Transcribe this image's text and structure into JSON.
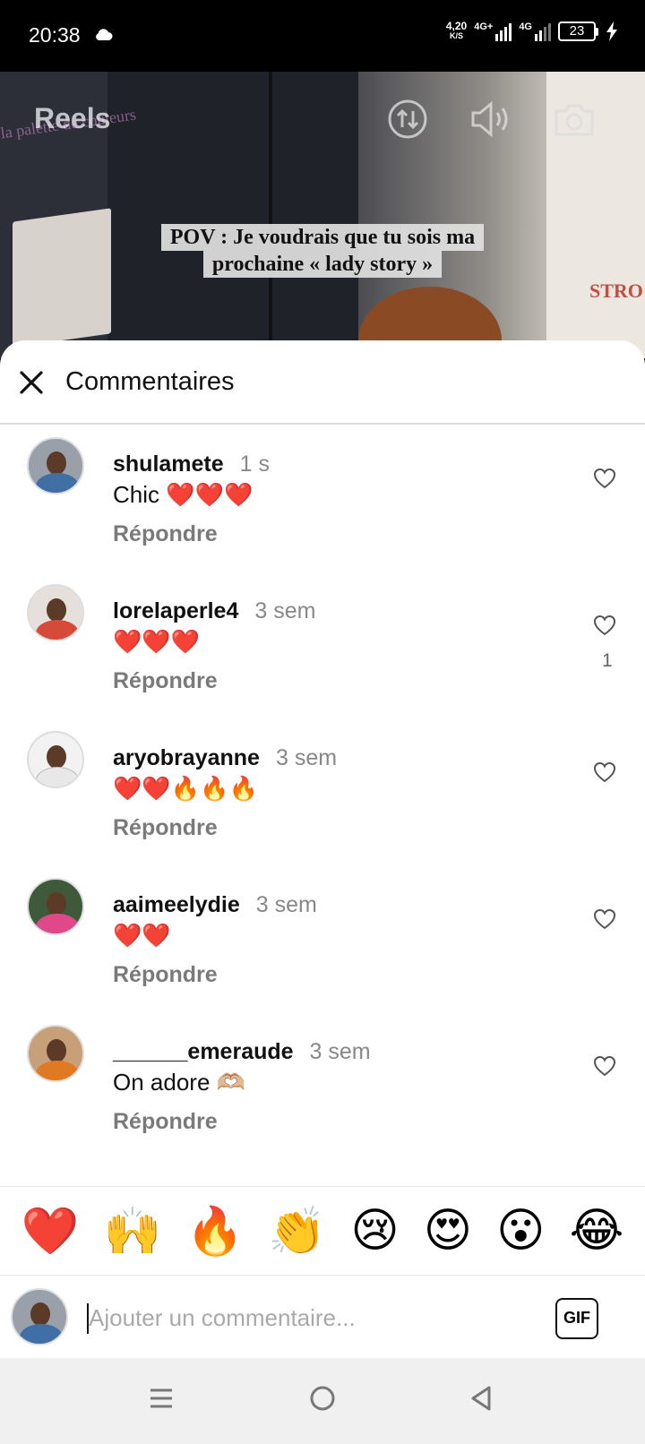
{
  "status_bar": {
    "time": "20:38",
    "net_speed_value": "4,20",
    "net_speed_unit": "K/S",
    "network1": "4G+",
    "network2": "4G",
    "battery": "23"
  },
  "reel": {
    "title": "Reels",
    "background_text": "la palette de couleurs",
    "banner_text": "STRO",
    "caption": "POV : Je voudrais que tu sois ma prochaine « lady story »"
  },
  "sheet": {
    "title": "Commentaires"
  },
  "comments": [
    {
      "username": "shulamete",
      "time": "1 s",
      "text": "Chic ❤️❤️❤️",
      "reply": "Répondre",
      "likes": ""
    },
    {
      "username": "lorelaperle4",
      "time": "3 sem",
      "text": "❤️❤️❤️",
      "reply": "Répondre",
      "likes": "1"
    },
    {
      "username": "aryobrayanne",
      "time": "3 sem",
      "text": "❤️❤️🔥🔥🔥",
      "reply": "Répondre",
      "likes": ""
    },
    {
      "username": "aaimeelydie",
      "time": "3 sem",
      "text": "❤️❤️",
      "reply": "Répondre",
      "likes": ""
    },
    {
      "username": "______emeraude",
      "time": "3 sem",
      "text": "On adore 🫶🏼",
      "reply": "Répondre",
      "likes": ""
    }
  ],
  "emoji_bar": [
    "❤️",
    "🙌",
    "🔥",
    "👏",
    "😢",
    "😍",
    "😮",
    "😂"
  ],
  "composer": {
    "placeholder": "Ajouter un commentaire...",
    "gif_label": "GIF"
  },
  "colors": {
    "accent_heart": "#ed4956",
    "text_primary": "#111111",
    "text_secondary": "#7a7a7a"
  }
}
